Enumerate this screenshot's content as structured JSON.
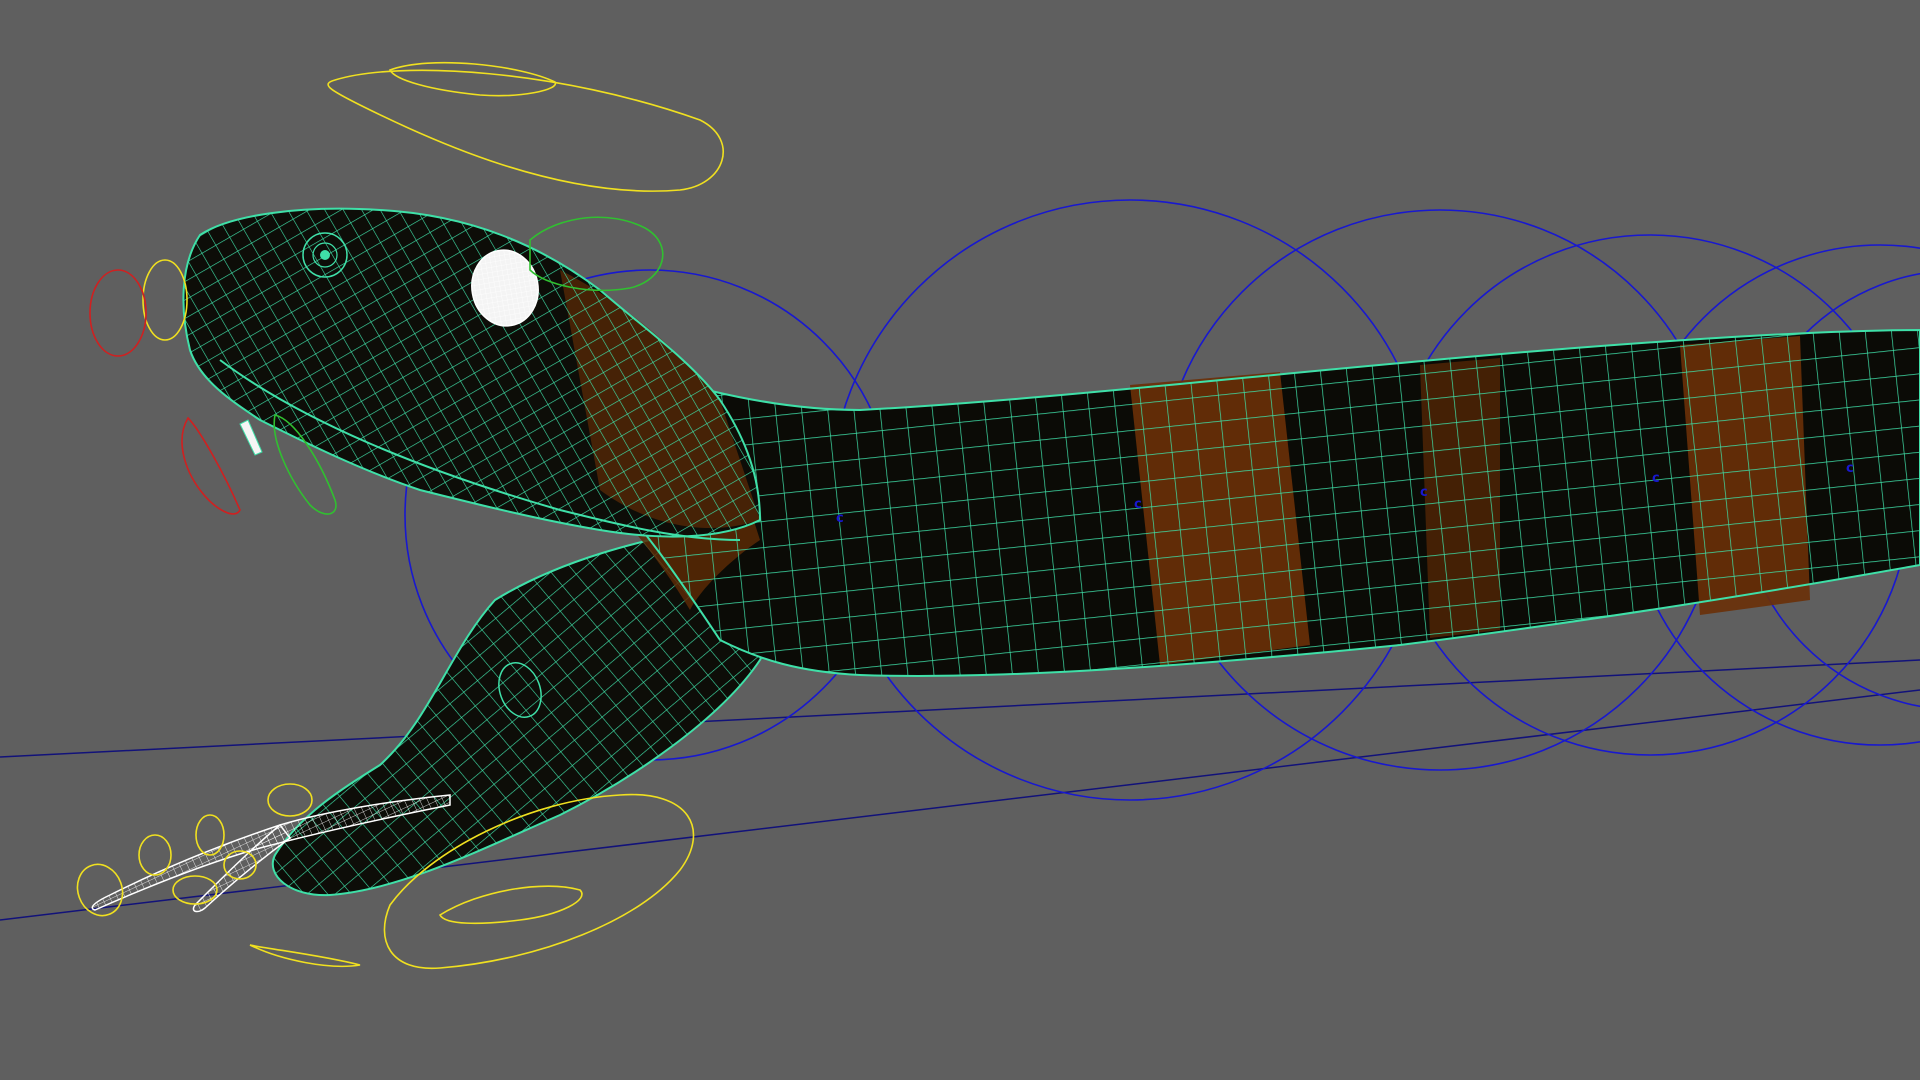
{
  "viewport": {
    "background": "#5f5f5f",
    "mesh_color": "#3fe0a8",
    "mesh_highlight": "#ffffff",
    "body_dark": "#0b0b06",
    "band_color": "#5a2a06",
    "ground_line_color": "#12127a"
  },
  "controls": {
    "spine_color": "#1818d0",
    "head_color": "#f0e020",
    "jaw_color": "#e8d820",
    "left_color": "#d02020",
    "right_color": "#30c030",
    "spine_labels": [
      "c",
      "c",
      "c",
      "c",
      "c"
    ],
    "spine_icon": "circle-nurbs-icon",
    "head_icon": "curve-nurbs-icon"
  },
  "model": {
    "parts": [
      "head",
      "upper-jaw",
      "lower-jaw",
      "eye",
      "tongue",
      "fang",
      "body"
    ],
    "eye_icon": "sphere-wireframe-icon"
  }
}
